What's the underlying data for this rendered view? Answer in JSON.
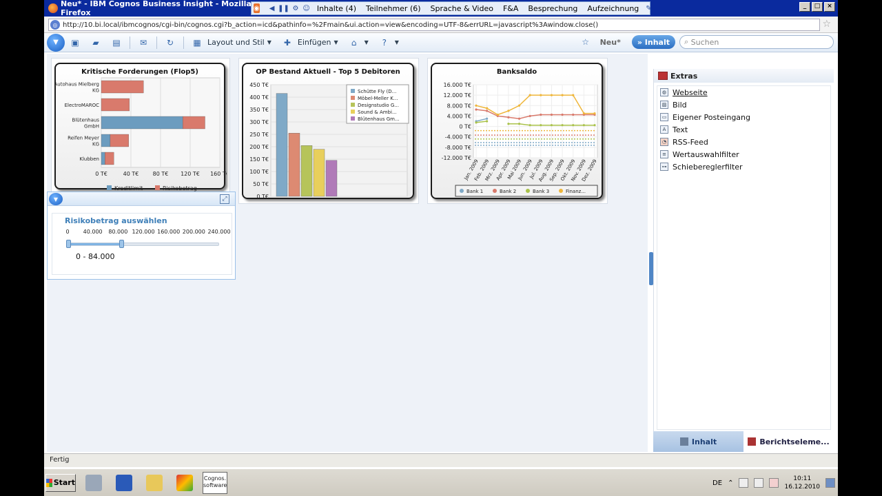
{
  "window": {
    "title": "Neu* - IBM Cognos Business Insight - Mozilla Firefox",
    "controls": [
      "_",
      "□",
      "×"
    ]
  },
  "meeting_bar": {
    "items": [
      "Inhalte (4)",
      "Teilnehmer (6)",
      "Sprache & Video",
      "F&A",
      "Besprechung",
      "Aufzeichnung"
    ]
  },
  "browser": {
    "url": "http://10.bi.local/ibmcognos/cgi-bin/cognos.cgi?b_action=icd&pathinfo=%2Fmain&ui.action=view&encoding=UTF-8&errURL=javascript%3Awindow.close()"
  },
  "toolbar": {
    "layout_label": "Layout und Stil",
    "insert_label": "Einfügen",
    "new_label": "Neu*",
    "content_button": "» Inhalt",
    "search_placeholder": "Suchen"
  },
  "chart_data": [
    {
      "type": "bar",
      "orientation": "horizontal",
      "stacked": true,
      "title": "Kritische Forderungen (Flop5)",
      "categories": [
        "Autohaus Mielberg KG",
        "ElectroMAROC",
        "Blütenhaus GmbH",
        "Reifen Meyer KG",
        "Klubben"
      ],
      "series": [
        {
          "name": "Kreditlimit",
          "color": "#6c9cbf",
          "values": [
            0,
            0,
            110,
            12,
            5
          ]
        },
        {
          "name": "Risikobetrag",
          "color": "#d97a6c",
          "values": [
            57,
            38,
            30,
            25,
            12
          ]
        }
      ],
      "xticks": [
        "0 T€",
        "40 T€",
        "80 T€",
        "120 T€",
        "160 T€"
      ],
      "xlim": [
        0,
        160
      ],
      "legend": "bottom"
    },
    {
      "type": "bar",
      "title": "OP Bestand Aktuell - Top 5 Debitoren",
      "categories": [
        "Schütte Fly (D...",
        "Möbel-Meller K...",
        "Designstudio G...",
        "Sound & Ambi...",
        "Blütenhaus Gm..."
      ],
      "values": [
        415,
        255,
        205,
        190,
        145
      ],
      "colors": [
        "#7fa9c7",
        "#dd8a72",
        "#b6c45a",
        "#e8cf5c",
        "#b07ab8"
      ],
      "yticks": [
        "0 T€",
        "50 T€",
        "100 T€",
        "150 T€",
        "200 T€",
        "250 T€",
        "300 T€",
        "350 T€",
        "400 T€",
        "450 T€"
      ],
      "ylim": [
        0,
        450
      ],
      "legend": "top-right"
    },
    {
      "type": "line",
      "title": "Banksaldo",
      "categories": [
        "Jan. 2009",
        "Feb. 2009",
        "Mrz. 2009",
        "Apr. 2009",
        "Mai 2009",
        "Jun. 2009",
        "Jul. 2009",
        "Aug. 2009",
        "Sep. 2009",
        "Okt. 2009",
        "Nov. 2009",
        "Dez. 2009"
      ],
      "yticks": [
        "-12.000 T€",
        "-8.000 T€",
        "-4.000 T€",
        "0 T€",
        "4.000 T€",
        "8.000 T€",
        "12.000 T€",
        "16.000 T€"
      ],
      "ylim": [
        -12000,
        16000
      ],
      "series": [
        {
          "name": "Bank 1",
          "color": "#7fa9c7",
          "values": [
            2000,
            3000,
            null,
            null,
            null,
            null,
            null,
            null,
            null,
            null,
            null,
            null
          ]
        },
        {
          "name": "Bank 2",
          "color": "#d97a6c",
          "values": [
            6500,
            6000,
            4000,
            3500,
            3000,
            4000,
            4500,
            4500,
            4500,
            4500,
            4500,
            4500
          ]
        },
        {
          "name": "Bank 3",
          "color": "#a9c24a",
          "values": [
            1500,
            2000,
            null,
            1000,
            1000,
            500,
            500,
            500,
            500,
            500,
            500,
            500
          ]
        },
        {
          "name": "Finanz...",
          "color": "#efb63a",
          "values": [
            8000,
            7000,
            4500,
            6000,
            8000,
            12000,
            12000,
            12000,
            12000,
            12000,
            5000,
            5000
          ]
        }
      ],
      "reference_lines": [
        {
          "color": "#efb63a",
          "value": -1600
        },
        {
          "color": "#d97a6c",
          "value": -3300
        },
        {
          "color": "#a9c24a",
          "value": -4800
        },
        {
          "color": "#7fa9c7",
          "value": -6200
        },
        {
          "color": "#7fa9c7",
          "value": -7200
        }
      ],
      "legend": "bottom"
    }
  ],
  "slider": {
    "title": "Risikobetrag auswählen",
    "ticks": [
      "0",
      "40.000",
      "80.000",
      "120.000",
      "160.000",
      "200.000",
      "240.000"
    ],
    "min": 0,
    "max": 240000,
    "selected_low": 0,
    "selected_high": 84000,
    "range_label": "0 - 84.000"
  },
  "right_pane": {
    "header": "Extras",
    "items": [
      {
        "label": "Webseite",
        "icon": "globe-icon"
      },
      {
        "label": "Bild",
        "icon": "image-icon"
      },
      {
        "label": "Eigener Posteingang",
        "icon": "inbox-icon"
      },
      {
        "label": "Text",
        "icon": "text-icon"
      },
      {
        "label": "RSS-Feed",
        "icon": "rss-icon"
      },
      {
        "label": "Wertauswahlfilter",
        "icon": "filter-list-icon"
      },
      {
        "label": "Schiebereglerfilter",
        "icon": "slider-filter-icon"
      }
    ],
    "tabs": [
      "Inhalt",
      "Berichtseleme..."
    ]
  },
  "statusbar": {
    "text": "Fertig"
  },
  "taskbar": {
    "start_label": "Start",
    "cognos_label_1": "Cognos.",
    "cognos_label_2": "software",
    "language": "DE",
    "time": "10:11",
    "date": "16.12.2010"
  }
}
